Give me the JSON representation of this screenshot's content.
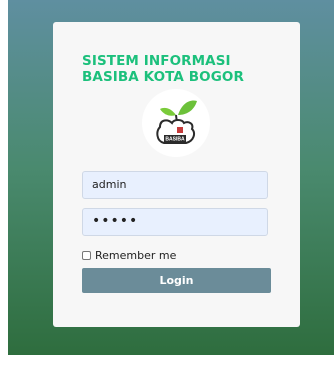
{
  "app": {
    "title_line1": "SISTEM INFORMASI",
    "title_line2": "BASIBA KOTA BOGOR",
    "logo_label": "BASIBA"
  },
  "form": {
    "username_value": "admin",
    "password_value": "•••••",
    "remember_label": "Remember me",
    "login_label": "Login"
  },
  "colors": {
    "accent": "#1cc07c",
    "button": "#6b8c99"
  }
}
